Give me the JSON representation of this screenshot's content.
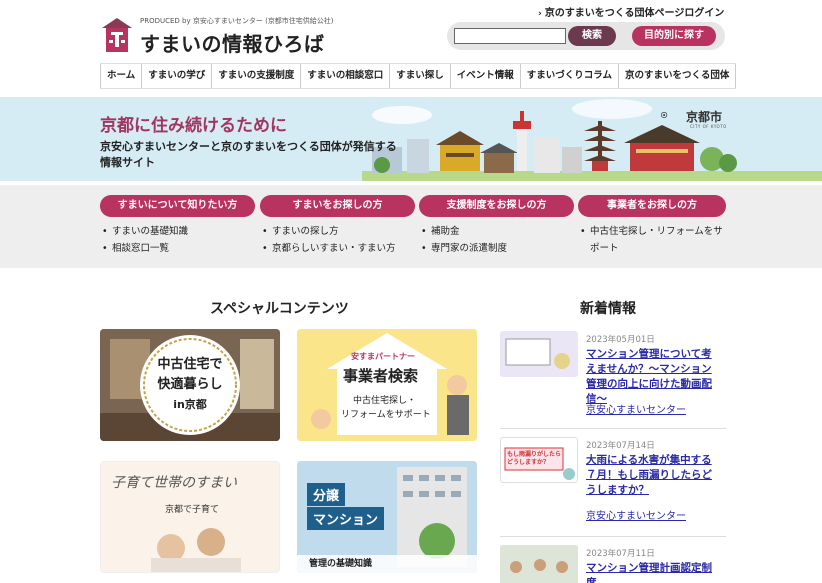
{
  "header": {
    "produced_by": "PRODUCED by 京安心すまいセンター (京都市住宅供給公社)",
    "site_title": "すまいの情報ひろば",
    "login_link": "京のすまいをつくる団体ページログイン",
    "search": {
      "value": "",
      "placeholder": ""
    },
    "search_button": "検索",
    "purpose_button": "目的別に探す"
  },
  "nav": {
    "items": [
      {
        "label": "ホーム"
      },
      {
        "label": "すまいの学び"
      },
      {
        "label": "すまいの支援制度"
      },
      {
        "label": "すまいの相談窓口"
      },
      {
        "label": "すまい探し"
      },
      {
        "label": "イベント情報"
      },
      {
        "label": "すまいづくりコラム"
      },
      {
        "label": "京のすまいをつくる団体"
      }
    ]
  },
  "hero": {
    "title": "京都に住み続けるために",
    "text": "京安心すまいセンターと京のすまいをつくる団体が発信する情報サイト",
    "city_logo": "京都市",
    "city_logo_sub": "CITY OF KYOTO"
  },
  "categories": [
    {
      "label": "すまいについて知りたい方",
      "items": [
        "すまいの基礎知識",
        "相談窓口一覧"
      ]
    },
    {
      "label": "すまいをお探しの方",
      "items": [
        "すまいの探し方",
        "京都らしいすまい・すまい方"
      ]
    },
    {
      "label": "支援制度をお探しの方",
      "items": [
        "補助金",
        "専門家の派遣制度"
      ]
    },
    {
      "label": "事業者をお探しの方",
      "items": [
        "中古住宅探し・リフォームをサポート"
      ]
    }
  ],
  "special": {
    "heading": "スペシャルコンテンツ",
    "tiles": [
      {
        "line1": "中古住宅で",
        "line2": "快適暮らし",
        "line3": "in京都"
      },
      {
        "tag": "安すまパートナー",
        "title": "事業者検索",
        "sub1": "中古住宅探し・",
        "sub2": "リフォームをサポート"
      },
      {
        "title": "子育て世帯のすまい",
        "sub": "京都で子育て"
      },
      {
        "line1": "分譲",
        "line2": "マンション",
        "caption": "管理の基礎知識"
      }
    ]
  },
  "news": {
    "heading": "新着情報",
    "items": [
      {
        "date": "2023年05月01日",
        "title": "マンション管理について考えませんか？〜マンション管理の向上に向けた動画配信〜",
        "org": "京安心すまいセンター"
      },
      {
        "date": "2023年07月14日",
        "title": "大雨による水害が集中する７月！もし雨漏りしたらどうしますか？",
        "org": "京安心すまいセンター",
        "thumb_text": "もし雨漏りがしたらどうしますか？"
      },
      {
        "date": "2023年07月11日",
        "title": "マンション管理計画認定制度",
        "org": ""
      }
    ]
  },
  "colors": {
    "accent": "#b8335f",
    "dark_button": "#6b3a4e",
    "hero_bg": "#d6ecf5",
    "band_bg": "#eeeeee"
  }
}
